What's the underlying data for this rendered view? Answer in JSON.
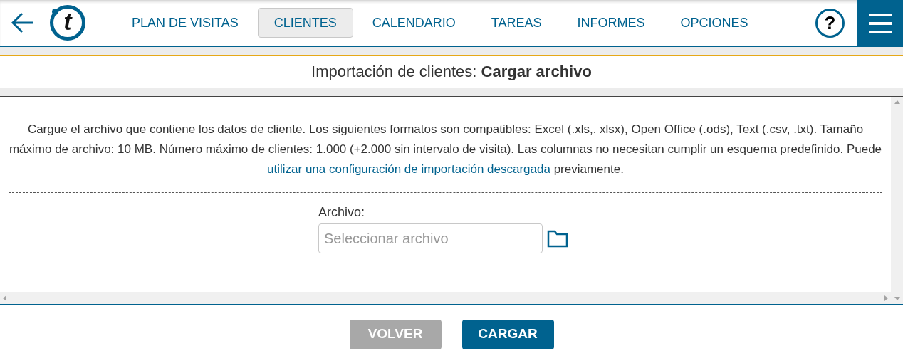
{
  "nav": [
    {
      "label": "PLAN DE VISITAS",
      "selected": false
    },
    {
      "label": "CLIENTES",
      "selected": true
    },
    {
      "label": "CALENDARIO",
      "selected": false
    },
    {
      "label": "TAREAS",
      "selected": false
    },
    {
      "label": "INFORMES",
      "selected": false
    },
    {
      "label": "OPCIONES",
      "selected": false
    }
  ],
  "help": "?",
  "logo_letter": "t",
  "page_title": {
    "prefix": "Importación de clientes:",
    "strong": "Cargar archivo"
  },
  "description": {
    "before": "Cargue el archivo que contiene los datos de cliente. Los siguientes formatos son compatibles: Excel (.xls,. xlsx), Open Office (.ods), Text (.csv, .txt). Tamaño máximo de archivo: 10 MB. Número máximo de clientes: 1.000 (+2.000 sin intervalo de visita). Las columnas no necesitan cumplir un esquema predefinido. Puede ",
    "link": "utilizar una configuración de importación descargada",
    "after": " previamente."
  },
  "file_field": {
    "label": "Archivo:",
    "placeholder": "Seleccionar archivo"
  },
  "buttons": [
    {
      "label": "VOLVER",
      "disabled": true
    },
    {
      "label": "CARGAR",
      "disabled": false
    }
  ]
}
